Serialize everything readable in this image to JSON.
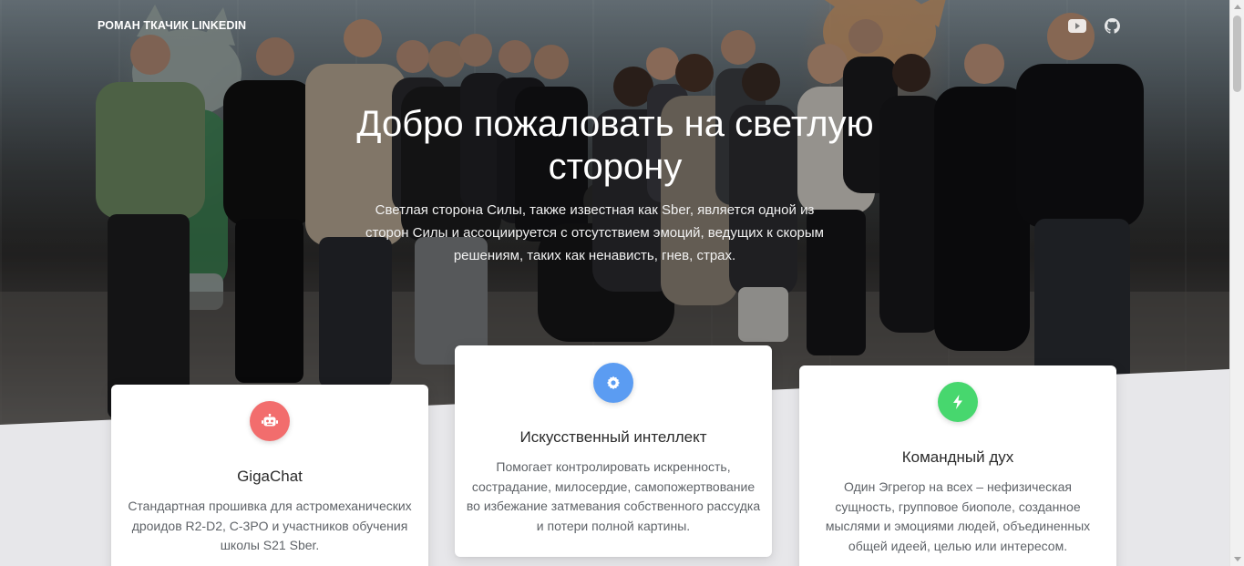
{
  "nav": {
    "brand": "РОМАН ТКАЧИК LINKEDIN",
    "icons": [
      "youtube-icon",
      "github-icon"
    ]
  },
  "hero": {
    "title": "Добро пожаловать на светлую сторону",
    "lead": "Светлая сторона Силы, также известная как Sber, является одной из сторон Силы и ассоциируется с отсутствием эмоций, ведущих к скорым решениям, таких как ненависть, гнев, страх."
  },
  "features": [
    {
      "icon": "robot-icon",
      "color": "#f26d6d",
      "title": "GigaChat",
      "text": "Стандартная прошивка для астромеханических дроидов R2-D2, C-3PO и участников обучения школы S21 Sber."
    },
    {
      "icon": "gear-icon",
      "color": "#5b9cf2",
      "title": "Искусственный интеллект",
      "text": "Помогает контролировать искренность, сострадание, милосердие, самопожертвование во избежание затмевания собственного рассудка и потери полной картины."
    },
    {
      "icon": "lightning-icon",
      "color": "#47d76e",
      "title": "Командный дух",
      "text": "Один Эгрегор на всех – нефизическая сущность, групповое биополе, созданное мыслями и эмоциями людей, объединенных общей идеей, целью или интересом."
    }
  ]
}
